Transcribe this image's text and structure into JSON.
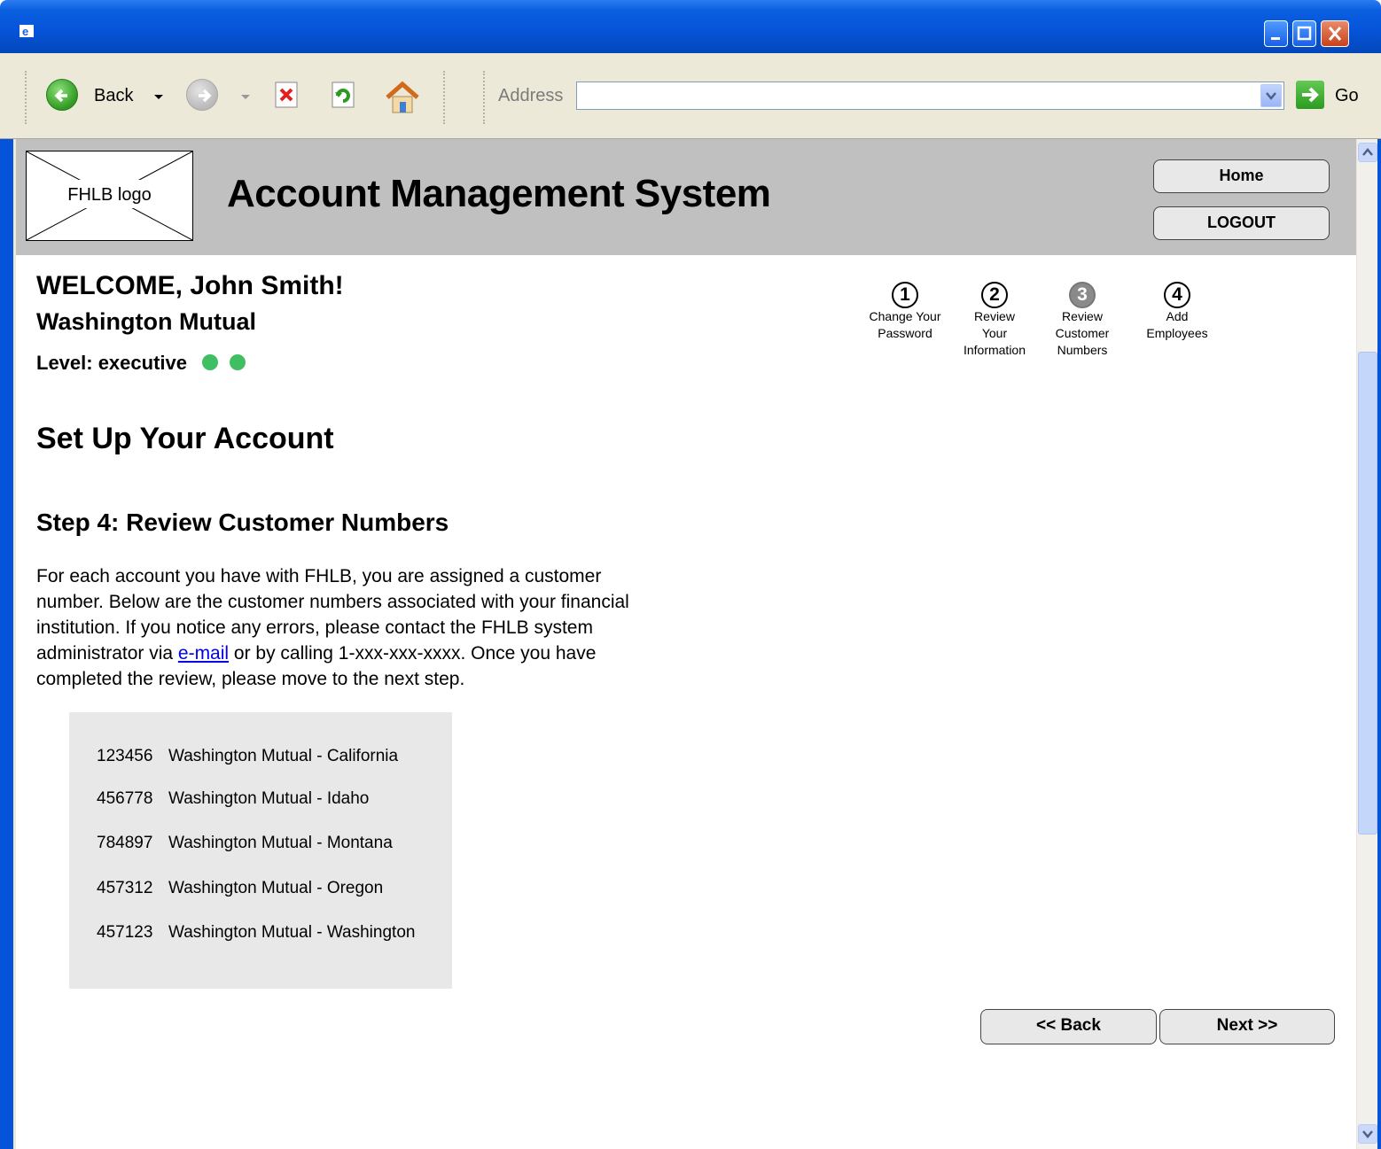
{
  "browser": {
    "back_label": "Back",
    "address_label": "Address",
    "address_value": "",
    "go_label": "Go"
  },
  "header": {
    "logo_text": "FHLB logo",
    "title": "Account Management System",
    "home_label": "Home",
    "logout_label": "LOGOUT"
  },
  "user": {
    "welcome": "WELCOME, John Smith!",
    "organization": "Washington Mutual",
    "level": "Level: executive",
    "level_color": "#3fbf62"
  },
  "steps": [
    {
      "number": "1",
      "label_lines": [
        "Change Your",
        "Password"
      ],
      "active": false
    },
    {
      "number": "2",
      "label_lines": [
        "Review",
        "Your",
        "Information"
      ],
      "active": false
    },
    {
      "number": "3",
      "label_lines": [
        "Review",
        "Customer",
        "Numbers"
      ],
      "active": true
    },
    {
      "number": "4",
      "label_lines": [
        "Add",
        "Employees"
      ],
      "active": false
    }
  ],
  "main": {
    "section_title": "Set Up Your Account",
    "step_title": "Step 4: Review Customer Numbers",
    "description_before_link": "For each account you have with FHLB, you are assigned a customer number. Below are the customer numbers associated with your financial institution. If you notice any errors, please contact the FHLB system administrator via ",
    "link_text": "e-mail",
    "description_after_link": " or by calling 1-xxx-xxx-xxxx. Once you have completed the review, please move to the next step.",
    "customers": [
      {
        "number": "123456",
        "name": "Washington Mutual - California"
      },
      {
        "number": "456778",
        "name": "Washington Mutual - Idaho"
      },
      {
        "number": "784897",
        "name": "Washington Mutual - Montana"
      },
      {
        "number": "457312",
        "name": "Washington Mutual - Oregon"
      },
      {
        "number": "457123",
        "name": "Washington Mutual - Washington"
      }
    ],
    "back_button": "<< Back",
    "next_button": "Next >>"
  }
}
